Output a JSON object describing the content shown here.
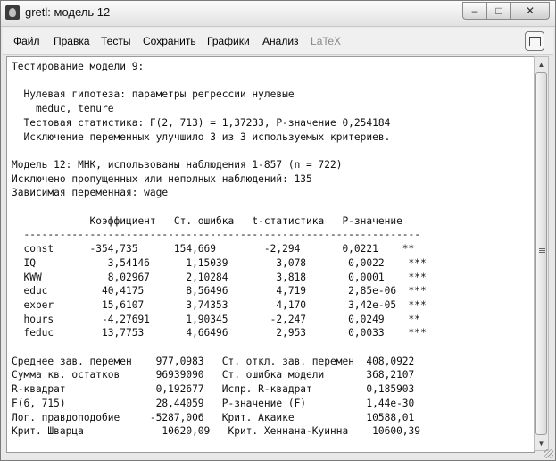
{
  "window": {
    "title": "gretl: модель 12"
  },
  "window_controls": {
    "minimize": "–",
    "maximize": "□",
    "close": "✕"
  },
  "menu": {
    "items": [
      "Файл",
      "Правка",
      "Тесты",
      "Сохранить",
      "Графики",
      "Анализ",
      "LaTeX"
    ]
  },
  "output_lines": [
    "Тестирование модели 9:",
    "",
    "  Нулевая гипотеза: параметры регрессии нулевые",
    "    meduc, tenure",
    "  Тестовая статистика: F(2, 713) = 1,37233, P-значение 0,254184",
    "  Исключение переменных улучшило 3 из 3 используемых критериев.",
    "",
    "Модель 12: МНК, использованы наблюдения 1-857 (n = 722)",
    "Исключено пропущенных или неполных наблюдений: 135",
    "Зависимая переменная: wage",
    "",
    "             Коэффициент   Ст. ошибка   t-статистика   P-значение",
    "  ------------------------------------------------------------------",
    "  const      -354,735      154,669        -2,294       0,0221    **",
    "  IQ            3,54146      1,15039        3,078       0,0022    ***",
    "  KWW           8,02967      2,10284        3,818       0,0001    ***",
    "  educ         40,4175       8,56496        4,719       2,85e-06  ***",
    "  exper        15,6107       3,74353        4,170       3,42e-05  ***",
    "  hours        -4,27691      1,90345       -2,247       0,0249    **",
    "  feduc        13,7753       4,66496        2,953       0,0033    ***",
    "",
    "Среднее зав. перемен    977,0983   Ст. откл. зав. перемен  408,0922",
    "Сумма кв. остатков      96939090   Ст. ошибка модели       368,2107",
    "R-квадрат               0,192677   Испр. R-квадрат         0,185903",
    "F(6, 715)               28,44059   Р-значение (F)          1,44e-30",
    "Лог. правдоподобие     -5287,006   Крит. Акаике            10588,01",
    "Крит. Шварца             10620,09   Крит. Хеннана-Куинна    10600,39"
  ]
}
